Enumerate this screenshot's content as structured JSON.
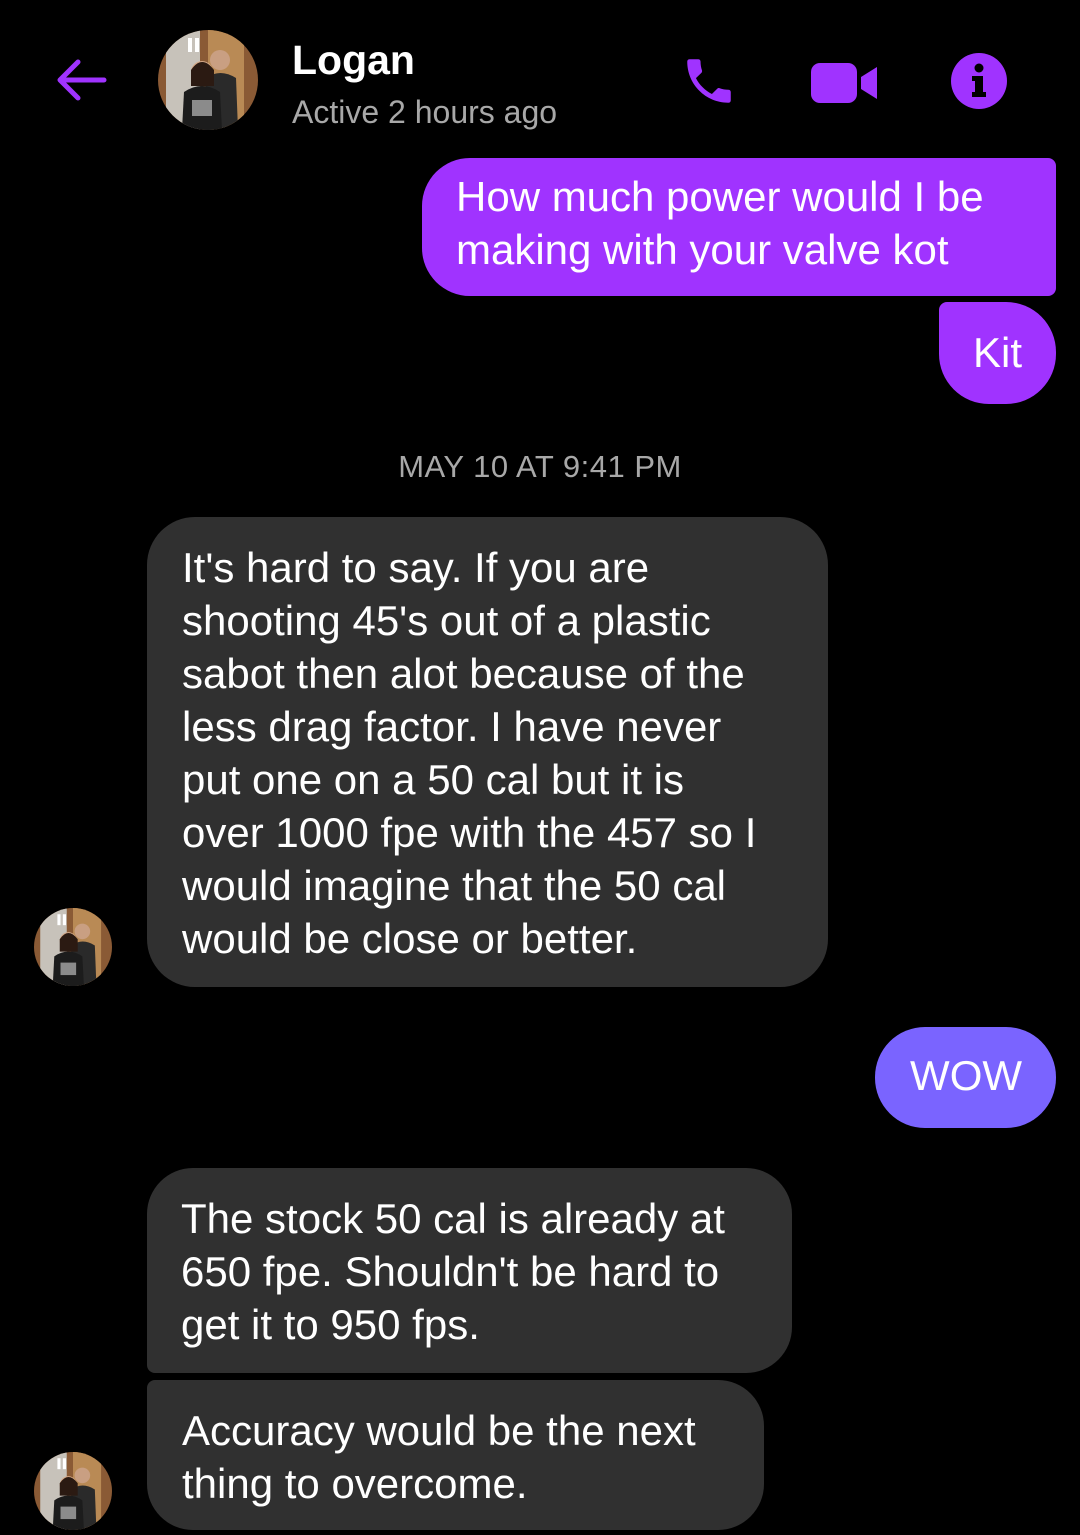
{
  "header": {
    "contact_name": "Logan",
    "status": "Active 2 hours ago",
    "back_icon": "arrow-left-icon",
    "call_icon": "phone-icon",
    "video_icon": "video-camera-icon",
    "info_icon": "info-icon"
  },
  "colors": {
    "accent": "#a033ff",
    "sent_bubble": "#a033ff",
    "sent_bubble_alt": "#7a64ff",
    "received_bubble": "#303030",
    "background": "#000000",
    "muted_text": "#a8a8a8"
  },
  "messages": [
    {
      "direction": "sent",
      "text": "How much power would I be\nmaking with your valve kot"
    },
    {
      "direction": "sent",
      "text": "Kit"
    },
    {
      "direction": "received",
      "text": "It's hard to say. If you are\nshooting 45's out of a plastic\nsabot then alot because of the\nless drag factor. I have never\nput one on a 50 cal but it is\nover 1000 fpe with the 457 so I\nwould imagine that the 50 cal\nwould be close or better."
    },
    {
      "direction": "sent",
      "text": "WOW"
    },
    {
      "direction": "received",
      "text": "The stock 50 cal is already at\n650 fpe. Shouldn't be hard to\nget it to 950 fps."
    },
    {
      "direction": "received",
      "text": "Accuracy would be the next\nthing to overcome."
    }
  ],
  "timestamp": "MAY 10 AT 9:41 PM"
}
